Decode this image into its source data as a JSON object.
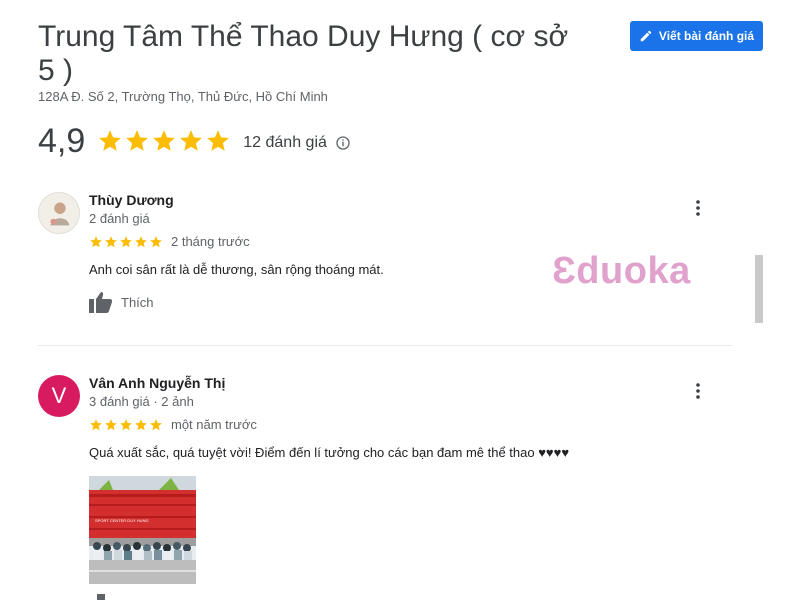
{
  "place": {
    "title": "Trung Tâm Thể Thao Duy Hưng ( cơ sở 5 )",
    "address": "128A Đ. Số 2, Trường Thọ, Thủ Đức, Hồ Chí Minh",
    "rating": "4,9",
    "rating_value": 4.9,
    "stars": 5,
    "review_count": "12 đánh giá"
  },
  "actions": {
    "write_review_label": "Viết bài đánh giá"
  },
  "reviews": [
    {
      "name": "Thùy Dương",
      "meta": "2 đánh giá",
      "stars": 5,
      "time": "2 tháng trước",
      "text": "Anh coi sân rất là dễ thương, sân rộng thoáng mát.",
      "like_label": "Thích",
      "avatar": "photo"
    },
    {
      "name": "Vân Anh Nguyễn Thị",
      "meta": "3 đánh giá · 2 ảnh",
      "stars": 5,
      "time": "một năm trước",
      "text": "Quá xuất sắc, quá tuyệt vời! Điểm đến lí tưởng cho các bạn đam mê thể thao ♥♥♥♥",
      "avatar_letter": "V",
      "photo_sign": "SPORT CENTER DUY HUNG"
    }
  ],
  "watermark": "Ɛduoka",
  "colors": {
    "accent": "#1a73e8",
    "star": "#fbbc04",
    "avatar_v": "#d81b60",
    "watermark": "#e0a2cc"
  },
  "icons": [
    "edit-icon",
    "star-icon",
    "info-icon",
    "more-vert-icon",
    "thumb-up-icon"
  ]
}
